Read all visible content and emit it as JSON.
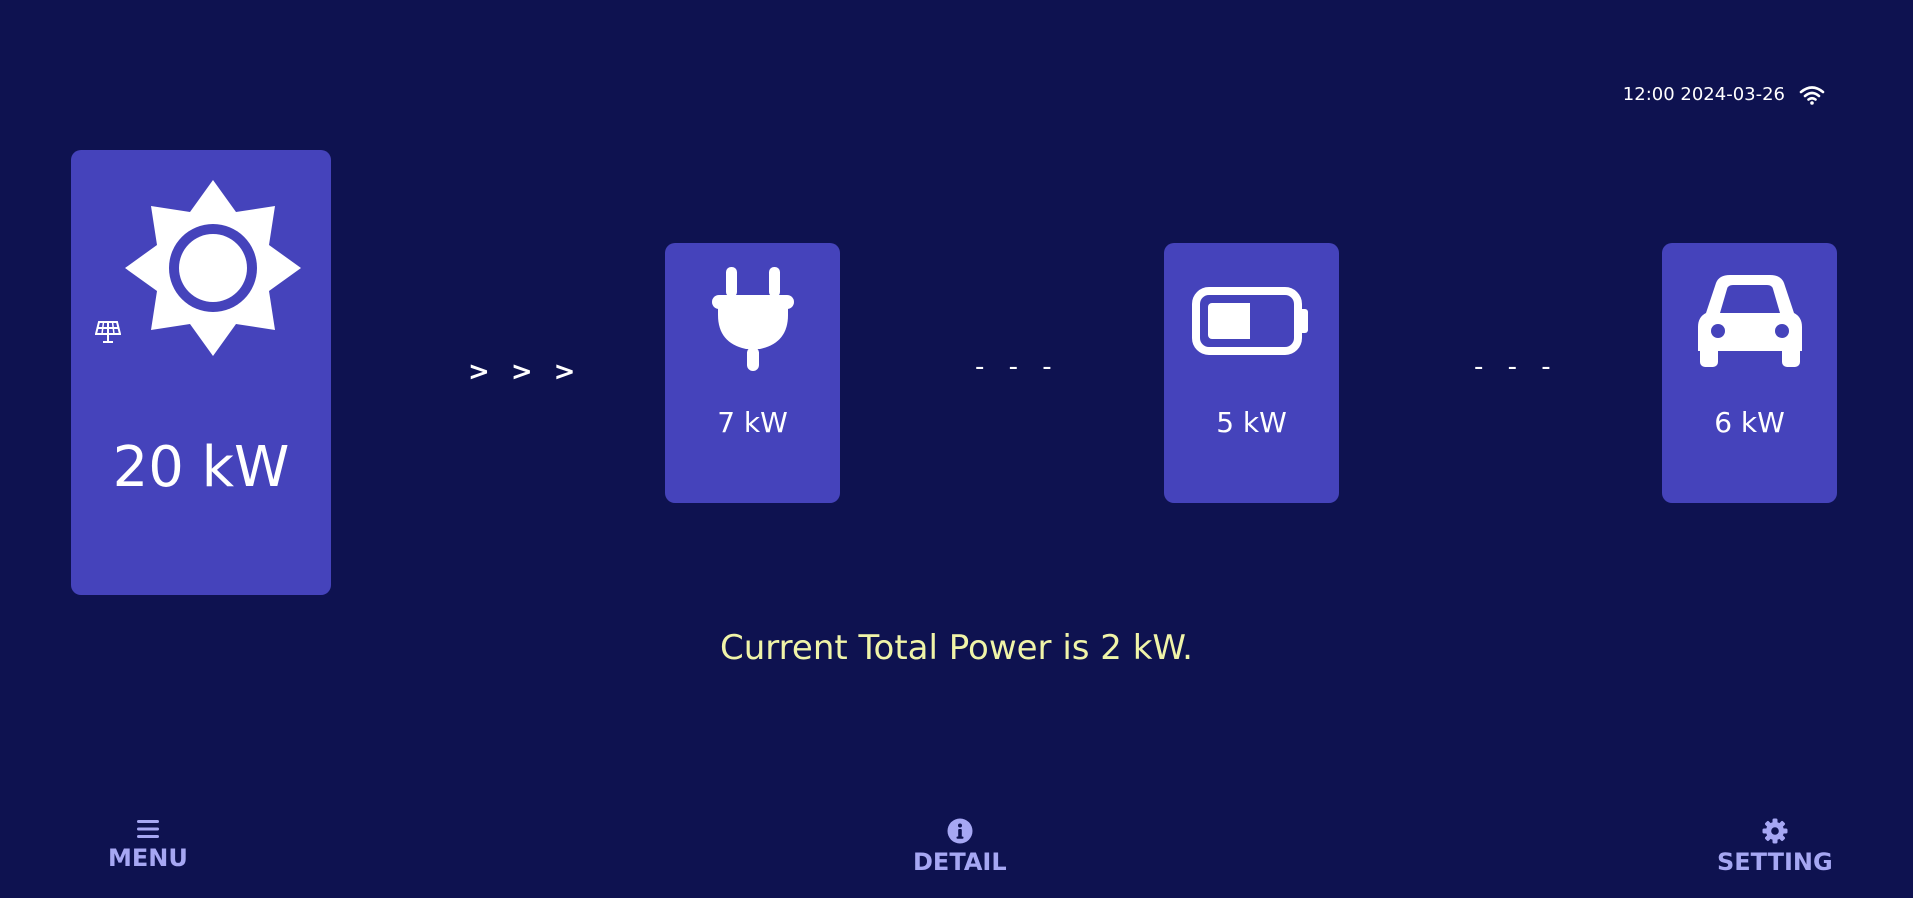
{
  "status": {
    "time_date": "12:00 2024-03-26",
    "wifi_icon": "wifi-icon"
  },
  "colors": {
    "background": "#0e1250",
    "card": "#4543bb",
    "summary_text": "#f0f4a8",
    "nav_text": "#a6a7f3"
  },
  "solar": {
    "icon": "sun-icon",
    "sub_icon": "solar-panel-icon",
    "value": "20 kW"
  },
  "flows": [
    "> > >",
    "- - -",
    "- - -"
  ],
  "grid": {
    "icon": "plug-icon",
    "value": "7 kW"
  },
  "battery": {
    "icon": "battery-icon",
    "value": "5 kW"
  },
  "car": {
    "icon": "car-icon",
    "value": "6 kW"
  },
  "summary": "Current Total Power is 2 kW.",
  "nav": {
    "menu": {
      "icon": "menu-icon",
      "label": "MENU"
    },
    "detail": {
      "icon": "info-icon",
      "label": "DETAIL"
    },
    "setting": {
      "icon": "gear-icon",
      "label": "SETTING"
    }
  }
}
